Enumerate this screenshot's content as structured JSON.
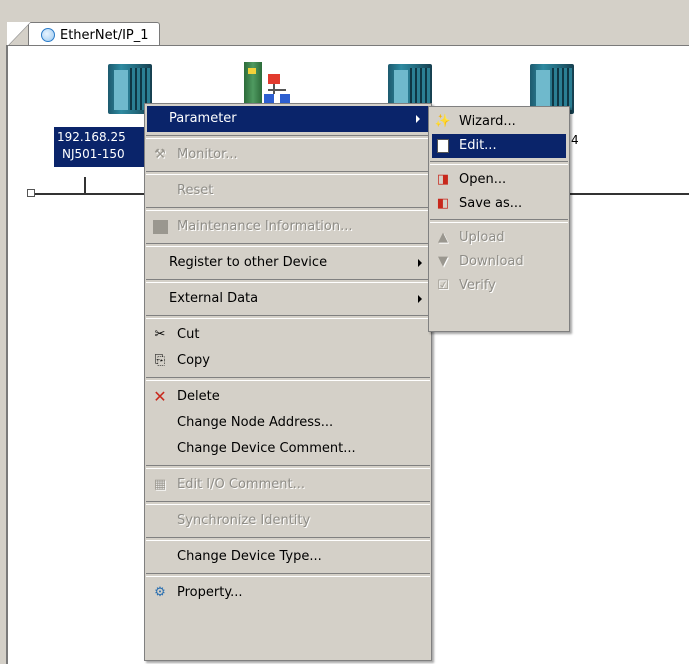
{
  "tab": {
    "label": "EtherNet/IP_1"
  },
  "node": {
    "address": "192.168.25",
    "model": "NJ501-150",
    "label_right": "4"
  },
  "main_menu": {
    "parameter": "Parameter",
    "monitor": "Monitor...",
    "reset": "Reset",
    "maintenance": "Maintenance Information...",
    "register": "Register to other Device",
    "external": "External Data",
    "cut": "Cut",
    "copy": "Copy",
    "delete": "Delete",
    "change_address": "Change Node Address...",
    "change_comment": "Change Device Comment...",
    "edit_io": "Edit I/O Comment...",
    "sync": "Synchronize Identity",
    "change_type": "Change Device Type...",
    "property": "Property..."
  },
  "sub_menu": {
    "wizard": "Wizard...",
    "edit": "Edit...",
    "open": "Open...",
    "save_as": "Save as...",
    "upload": "Upload",
    "download": "Download",
    "verify": "Verify"
  },
  "colors": {
    "highlight": "#0a246a",
    "menu_bg": "#d4d0c8",
    "disabled_text": "#8f8d87"
  }
}
